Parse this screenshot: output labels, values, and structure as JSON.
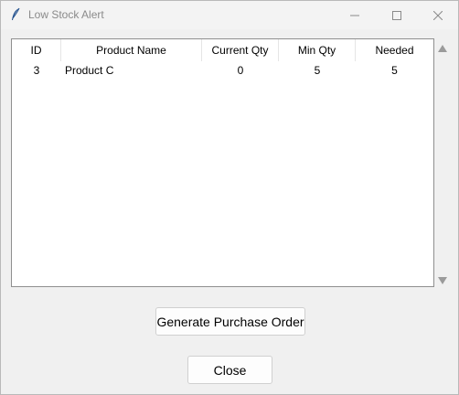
{
  "window": {
    "title": "Low Stock Alert",
    "icon": "feather-icon"
  },
  "table": {
    "columns": [
      "ID",
      "Product Name",
      "Current Qty",
      "Min Qty",
      "Needed"
    ],
    "rows": [
      [
        "3",
        "Product C",
        "0",
        "5",
        "5"
      ]
    ]
  },
  "buttons": {
    "generate_po": "Generate Purchase Order",
    "close": "Close"
  }
}
